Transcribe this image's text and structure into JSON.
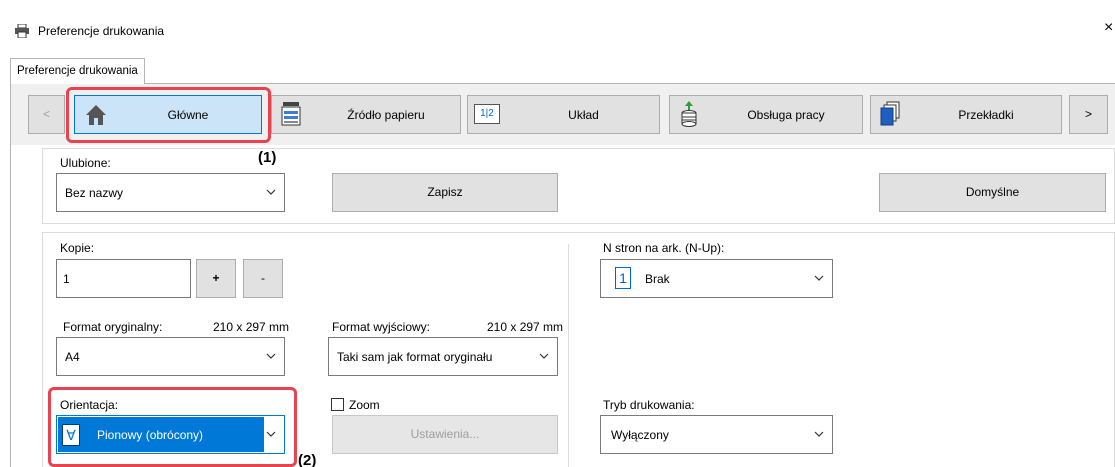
{
  "window": {
    "title": "Preferencje drukowania",
    "close": "×"
  },
  "tab": {
    "label": "Preferencje drukowania"
  },
  "nav": {
    "prev": "<",
    "next": ">",
    "items": [
      {
        "label": "Główne",
        "icon": "home-icon"
      },
      {
        "label": "Źródło papieru",
        "icon": "paper-tray-icon"
      },
      {
        "label": "Układ",
        "icon": "layout-icon",
        "icon_text": "1|2"
      },
      {
        "label": "Obsługa pracy",
        "icon": "job-handling-icon"
      },
      {
        "label": "Przekładki",
        "icon": "inserts-icon"
      }
    ]
  },
  "callouts": {
    "one": "(1)",
    "two": "(2)"
  },
  "favorites": {
    "label": "Ulubione:",
    "value": "Bez nazwy",
    "save": "Zapisz",
    "defaults": "Domyślne"
  },
  "copies": {
    "label": "Kopie:",
    "value": "1",
    "plus": "+",
    "minus": "-"
  },
  "original_size": {
    "label": "Format oryginalny:",
    "dims": "210 x 297 mm",
    "value": "A4"
  },
  "output_size": {
    "label": "Format wyjściowy:",
    "dims": "210 x 297 mm",
    "value": "Taki sam jak format oryginału"
  },
  "orientation": {
    "label": "Orientacja:",
    "value": "Pionowy (obrócony)",
    "icon_glyph": "∀"
  },
  "zoom": {
    "label": "Zoom",
    "settings": "Ustawienia..."
  },
  "nup": {
    "label": "N stron na ark. (N-Up):",
    "value": "Brak",
    "icon_text": "1"
  },
  "print_mode": {
    "label": "Tryb drukowania:",
    "value": "Wyłączony"
  },
  "colors": {
    "highlight": "#e8434f",
    "selected": "#0078d7",
    "active_tab": "#cce4f7"
  }
}
